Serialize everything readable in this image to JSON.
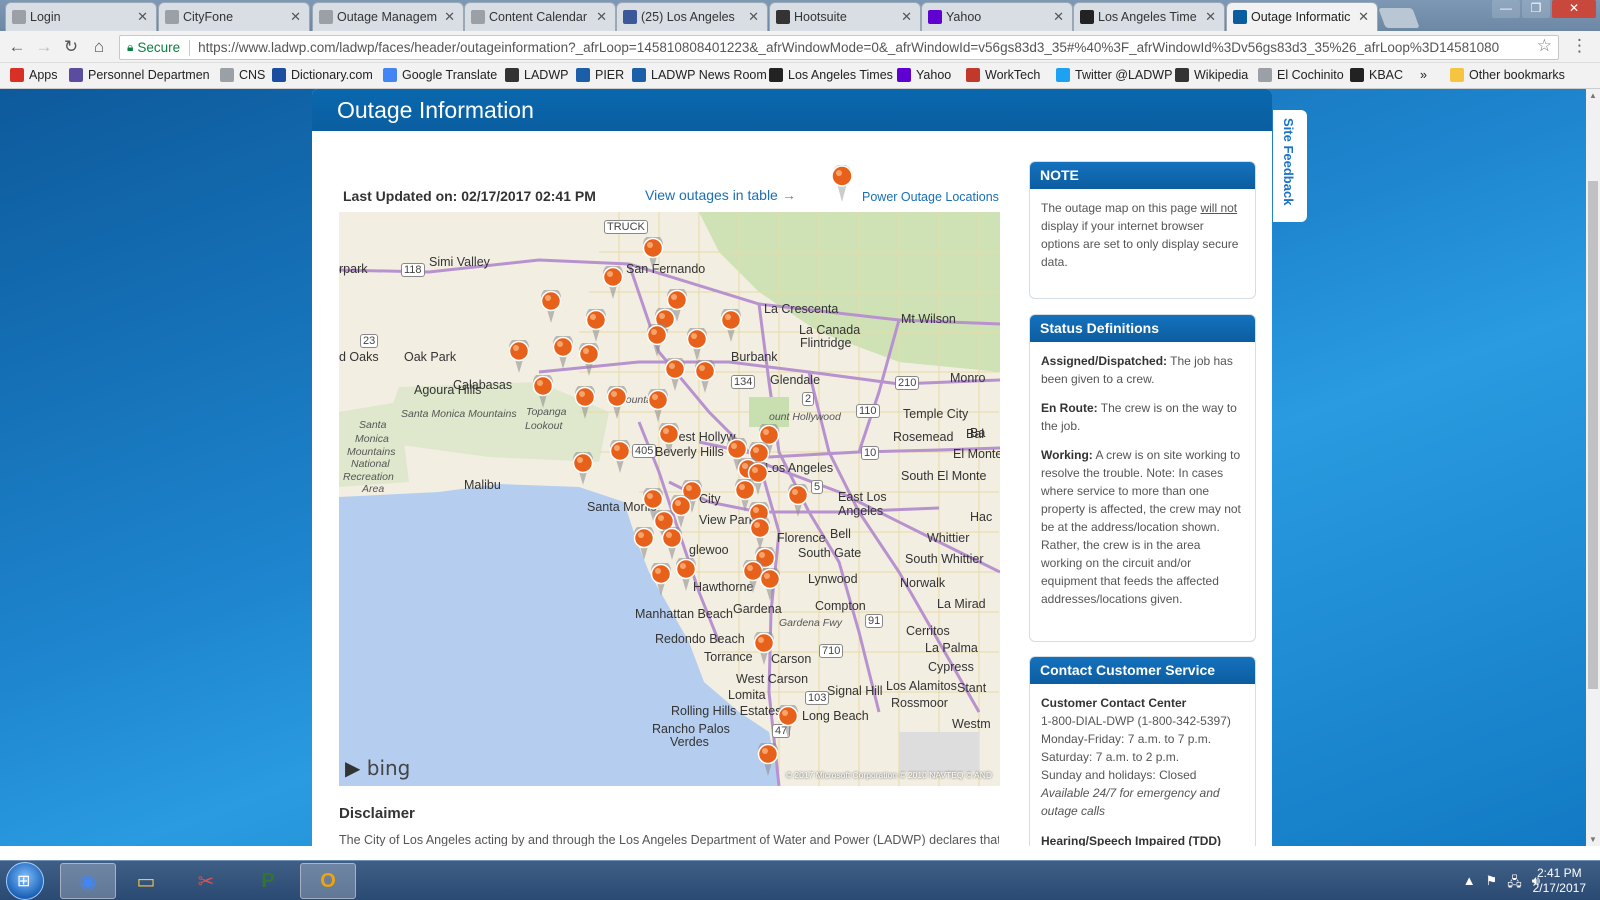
{
  "browser": {
    "tabs": [
      {
        "title": "Login",
        "icon": "page-icon",
        "color": "#9aa0a6"
      },
      {
        "title": "CityFone",
        "icon": "page-icon",
        "color": "#9aa0a6"
      },
      {
        "title": "Outage Managem",
        "icon": "page-icon",
        "color": "#9aa0a6"
      },
      {
        "title": "Content Calendar",
        "icon": "loading-icon",
        "color": "#9aa0a6"
      },
      {
        "title": "(25) Los Angeles",
        "icon": "facebook-icon",
        "color": "#3b5998"
      },
      {
        "title": "Hootsuite",
        "icon": "hootsuite-icon",
        "color": "#333333"
      },
      {
        "title": "Yahoo",
        "icon": "yahoo-icon",
        "color": "#5f01d1"
      },
      {
        "title": "Los Angeles Time",
        "icon": "latimes-icon",
        "color": "#222222"
      },
      {
        "title": "Outage Informatic",
        "icon": "ladwp-icon",
        "color": "#0a5ea0",
        "active": true
      }
    ],
    "address": {
      "secure_label": "Secure",
      "url": "https://www.ladwp.com/ladwp/faces/header/outageinformation?_afrLoop=145810808401223&_afrWindowMode=0&_afrWindowId=v56gs83d3_35#%40%3F_afrWindowId%3Dv56gs83d3_35%26_afrLoop%3D14581080"
    },
    "bookmarks": [
      {
        "label": "Apps",
        "icon": "apps-icon",
        "color": "#d93025"
      },
      {
        "label": "Personnel Departmen",
        "icon": "personnel-icon",
        "color": "#5b4c9f"
      },
      {
        "label": "CNS",
        "icon": "page-icon",
        "color": "#9aa0a6"
      },
      {
        "label": "Dictionary.com",
        "icon": "dictionary-icon",
        "color": "#1c4ea0"
      },
      {
        "label": "Google Translate",
        "icon": "translate-icon",
        "color": "#4285f4"
      },
      {
        "label": "LADWP",
        "icon": "ladwp-icon",
        "color": "#333333"
      },
      {
        "label": "PIER",
        "icon": "pier-icon",
        "color": "#1a5fa8"
      },
      {
        "label": "LADWP News Room",
        "icon": "newsroom-icon",
        "color": "#1a5fa8"
      },
      {
        "label": "Los Angeles Times",
        "icon": "latimes-icon",
        "color": "#222222"
      },
      {
        "label": "Yahoo",
        "icon": "yahoo-icon",
        "color": "#5f01d1"
      },
      {
        "label": "WorkTech",
        "icon": "worktech-icon",
        "color": "#c0392b"
      },
      {
        "label": "Twitter @LADWP",
        "icon": "twitter-icon",
        "color": "#1da1f2"
      },
      {
        "label": "Wikipedia",
        "icon": "wikipedia-icon",
        "color": "#333333"
      },
      {
        "label": "El Cochinito",
        "icon": "page-icon",
        "color": "#9aa0a6"
      },
      {
        "label": "KBAC",
        "icon": "kbac-icon",
        "color": "#222222"
      }
    ],
    "bookmarks_overflow": "»",
    "other_bookmarks": "Other bookmarks"
  },
  "page": {
    "header_title": "Outage Information",
    "site_feedback": "Site Feedback",
    "last_updated": "Last Updated on: 02/17/2017 02:41 PM",
    "view_table_link": "View outages in table",
    "legend_label": "Power Outage Locations",
    "pin_color": "#e8611a",
    "map_credit": "bing",
    "map_copyright": "© 2017 Microsoft Corporation   © 2010 NAVTEQ   © AND",
    "map_labels": [
      {
        "t": "Simi Valley"
      },
      {
        "t": "San Fernando"
      },
      {
        "t": "La Crescenta"
      },
      {
        "t": "Mt Wilson"
      },
      {
        "t": "La Canada"
      },
      {
        "t": "Flintridge"
      },
      {
        "t": "Oak Park"
      },
      {
        "t": "d Oaks"
      },
      {
        "t": "Burbank"
      },
      {
        "t": "Glendale"
      },
      {
        "t": "Agoura Hills"
      },
      {
        "t": "Calabasas"
      },
      {
        "t": "Monro"
      },
      {
        "t": "Temple City"
      },
      {
        "t": "Rosemead"
      },
      {
        "t": "El Monte"
      },
      {
        "t": "South El Monte"
      },
      {
        "t": "West Hollyw"
      },
      {
        "t": "Beverly Hills"
      },
      {
        "t": "Los Angeles"
      },
      {
        "t": "Malibu"
      },
      {
        "t": "City"
      },
      {
        "t": "Santa Monic"
      },
      {
        "t": "View Park"
      },
      {
        "t": "East Los"
      },
      {
        "t": "Angeles"
      },
      {
        "t": "Bell"
      },
      {
        "t": "Whittier"
      },
      {
        "t": "South Whittier"
      },
      {
        "t": "Florence"
      },
      {
        "t": "South Gate"
      },
      {
        "t": "glewoo"
      },
      {
        "t": "Lynwood"
      },
      {
        "t": "Hawthorne"
      },
      {
        "t": "Norwalk"
      },
      {
        "t": "Manhattan Beach"
      },
      {
        "t": "Gardena"
      },
      {
        "t": "Compton"
      },
      {
        "t": "La Mirad"
      },
      {
        "t": "Redondo Beach"
      },
      {
        "t": "Cerritos"
      },
      {
        "t": "La Palma"
      },
      {
        "t": "Torrance"
      },
      {
        "t": "Carson"
      },
      {
        "t": "Cypress"
      },
      {
        "t": "West Carson"
      },
      {
        "t": "Signal Hill"
      },
      {
        "t": "Los Alamitos"
      },
      {
        "t": "Lomita"
      },
      {
        "t": "Rolling Hills Estates"
      },
      {
        "t": "Long Beach"
      },
      {
        "t": "Rossmoor"
      },
      {
        "t": "Rancho Palos"
      },
      {
        "t": "Verdes"
      },
      {
        "t": "Westm"
      },
      {
        "t": "Stant"
      },
      {
        "t": "rpark"
      },
      {
        "t": "Hac"
      },
      {
        "t": "Ba"
      },
      {
        "t": "Bal"
      },
      {
        "t": "Santa Monica Mountains"
      },
      {
        "t": "Topanga"
      },
      {
        "t": "Lookout"
      },
      {
        "t": "Santa"
      },
      {
        "t": "Monica"
      },
      {
        "t": "Mountains"
      },
      {
        "t": "National"
      },
      {
        "t": "Recreation"
      },
      {
        "t": "Area"
      },
      {
        "t": "Mountai"
      },
      {
        "t": "ount Hollywood"
      },
      {
        "t": "Gardena Fwy"
      },
      {
        "t": "TRUCK"
      },
      {
        "t": "118"
      },
      {
        "t": "23"
      },
      {
        "t": "134"
      },
      {
        "t": "2"
      },
      {
        "t": "110"
      },
      {
        "t": "210"
      },
      {
        "t": "10"
      },
      {
        "t": "5"
      },
      {
        "t": "405"
      },
      {
        "t": "91"
      },
      {
        "t": "710"
      },
      {
        "t": "103"
      },
      {
        "t": "47"
      }
    ],
    "disclaimer_title": "Disclaimer",
    "disclaimer_text": "The City of Los Angeles acting by and through the Los Angeles Department of Water and Power (LADWP) declares that"
  },
  "sidebar": {
    "note": {
      "title": "NOTE",
      "text_1": "The outage map on this page ",
      "text_emph": "will not",
      "text_2": " display if your internet browser options are set to only display secure data."
    },
    "status": {
      "title": "Status Definitions",
      "items": [
        {
          "term": "Assigned/Dispatched:",
          "desc": " The job has been given to a crew."
        },
        {
          "term": "En Route:",
          "desc": " The crew is on the way to the job."
        },
        {
          "term": "Working:",
          "desc": " A crew is on site working to resolve the trouble. Note: In cases where service to more than one property is affected, the crew may not be at the address/location shown. Rather, the crew is in the area working on the circuit and/or equipment that feeds the affected addresses/locations given."
        }
      ]
    },
    "contact": {
      "title": "Contact Customer Service",
      "center_label": "Customer Contact Center",
      "phone": "1-800-DIAL-DWP (1-800-342-5397)",
      "hours_weekday": "Monday-Friday: 7 a.m. to 7 p.m.",
      "hours_saturday": "Saturday: 7 a.m. to 2 p.m.",
      "hours_sunday": "Sunday and holidays: Closed",
      "emergency": "Available 24/7 for emergency and outage calls",
      "tdd_label": "Hearing/Speech Impaired (TDD)"
    }
  },
  "taskbar": {
    "items": [
      {
        "name": "chrome-icon",
        "glyph": "◉",
        "color": "#4285f4"
      },
      {
        "name": "file-explorer-icon",
        "glyph": "▭",
        "color": "#f4c542"
      },
      {
        "name": "snipping-tool-icon",
        "glyph": "✂",
        "color": "#d9534f"
      },
      {
        "name": "project-icon",
        "glyph": "P",
        "color": "#31752f"
      },
      {
        "name": "outlook-icon",
        "glyph": "O",
        "color": "#f0a30a"
      }
    ],
    "time": "2:41 PM",
    "date": "2/17/2017"
  }
}
